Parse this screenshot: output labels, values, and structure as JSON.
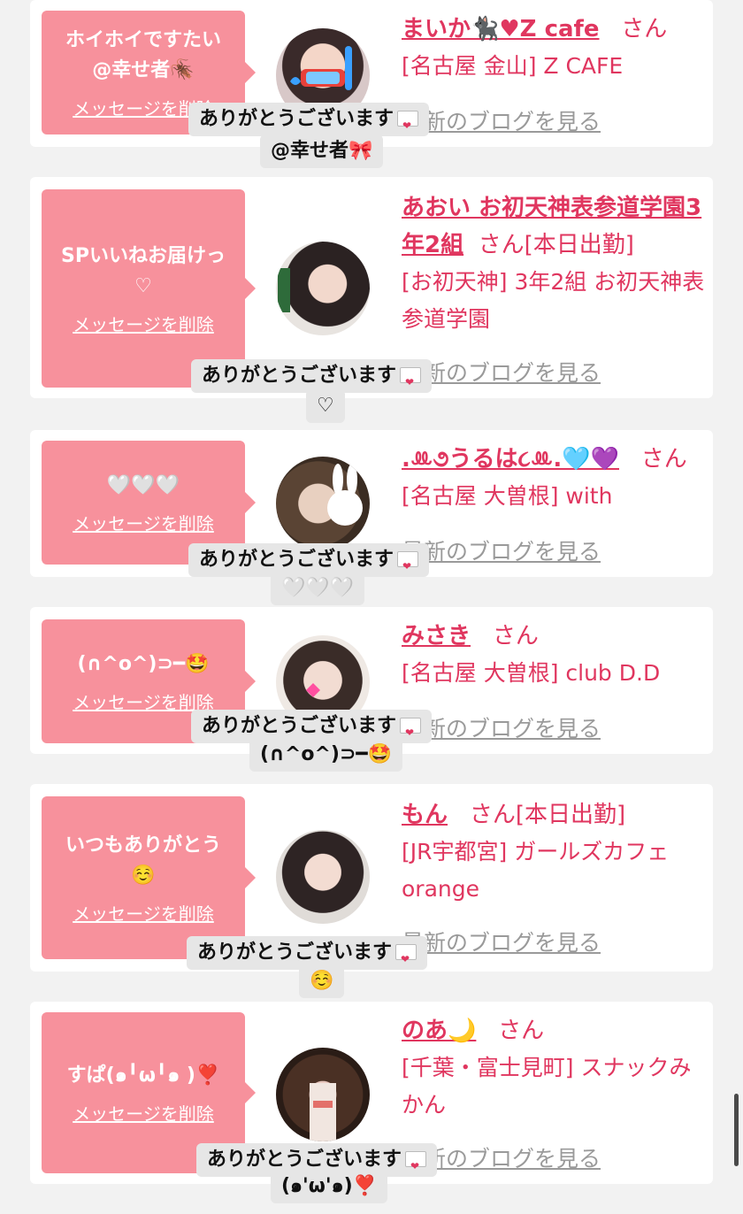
{
  "reply_text": "ありがとうございます",
  "delete_label": "メッセージを削除",
  "san": "さん",
  "blog_label": "最新のブログを見る",
  "colors": {
    "bubble": "#f7919c",
    "accent": "#e0365f",
    "card": "#ffffff",
    "background": "#f2f2f2"
  },
  "cards": [
    {
      "bubble_text": "ホイホイですたい\n@幸せ者🪳",
      "name": "まいか🐈‍⬛♥Z cafe",
      "suffix": "",
      "shop": "[名古屋 金山] Z CAFE",
      "reply_sub": "@幸せ者🎀"
    },
    {
      "bubble_text": "SPいいねお届けっ\n♡",
      "name": "あおい お初天神表参道学園3年2組",
      "suffix": "[本日出勤]",
      "shop": "[お初天神] 3年2組 お初天神表参道学園",
      "reply_sub": "♡"
    },
    {
      "bubble_text": "🤍🤍🤍",
      "name": ".ꔛ૭うるは૮ꔛ.🩵💜",
      "suffix": "",
      "shop": "[名古屋 大曽根] with",
      "reply_sub": "🤍🤍🤍"
    },
    {
      "bubble_text": "(∩^o^)⊃━🤩",
      "name": "みさき",
      "suffix": "",
      "shop": "[名古屋 大曽根] club D.D",
      "reply_sub": "(∩^o^)⊃━🤩"
    },
    {
      "bubble_text": "いつもありがとう\n☺️",
      "name": "もん",
      "suffix": "[本日出勤]",
      "shop": "[JR宇都宮] ガールズカフェorange",
      "reply_sub": "☺️"
    },
    {
      "bubble_text": "すぱ(๑╹ω╹๑ )❣️",
      "name": "のあ🌙",
      "suffix": "",
      "shop": "[千葉・富士見町] スナックみかん",
      "reply_sub": "(๑'ω'๑)❣️"
    }
  ]
}
